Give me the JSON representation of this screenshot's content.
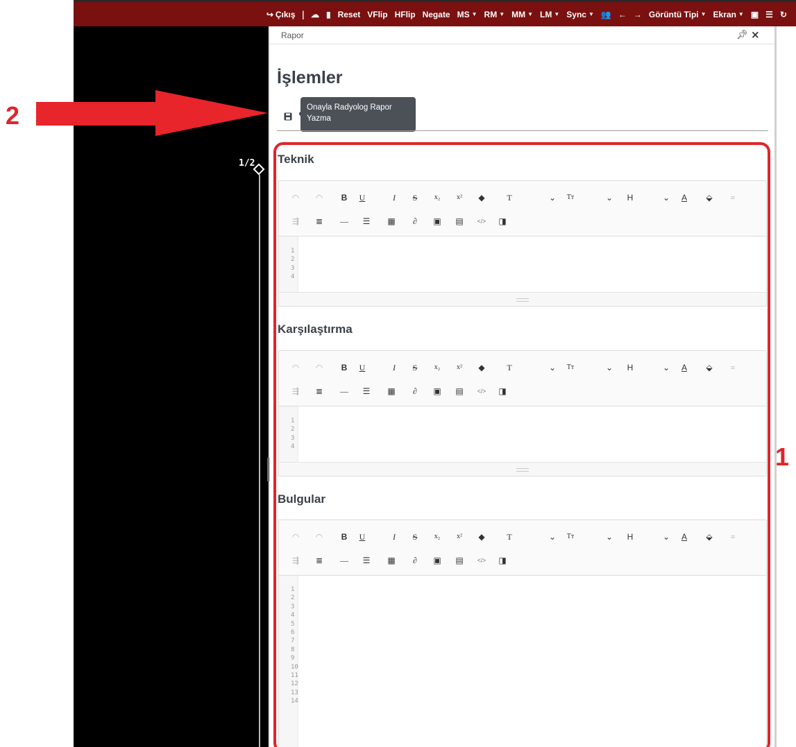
{
  "toolbar": {
    "items": [
      {
        "label": "Çıkış",
        "icon": "logout-icon"
      },
      {
        "label": "|",
        "icon": ""
      },
      {
        "label": "",
        "icon": "cloud-icon"
      },
      {
        "label": "",
        "icon": "file-icon"
      },
      {
        "label": "Reset",
        "icon": ""
      },
      {
        "label": "VFlip",
        "icon": ""
      },
      {
        "label": "HFlip",
        "icon": ""
      },
      {
        "label": "Negate",
        "icon": ""
      },
      {
        "label": "MS",
        "icon": "caret-down-icon"
      },
      {
        "label": "RM",
        "icon": "caret-down-icon"
      },
      {
        "label": "MM",
        "icon": "caret-down-icon"
      },
      {
        "label": "LM",
        "icon": "caret-down-icon"
      },
      {
        "label": "Sync",
        "icon": "caret-down-icon"
      },
      {
        "label": "",
        "icon": "users-icon"
      },
      {
        "label": "←",
        "icon": "arrow-left-icon"
      },
      {
        "label": "→",
        "icon": "arrow-right-icon"
      },
      {
        "label": "Görüntü Tipi",
        "icon": "caret-down-icon"
      },
      {
        "label": "Ekran",
        "icon": "caret-down-icon"
      },
      {
        "label": "",
        "icon": "image-icon"
      },
      {
        "label": "",
        "icon": "list-icon"
      },
      {
        "label": "",
        "icon": "refresh-icon"
      }
    ]
  },
  "viewer": {
    "image_counter": "1/2"
  },
  "panel": {
    "title": "Rapor",
    "pin": "📌",
    "close": "×"
  },
  "page": {
    "title": "İşlemler",
    "save_tooltip": "Onayla Radyolog Rapor Yazma"
  },
  "sections": [
    {
      "title": "Teknik",
      "line_numbers": [
        "1",
        "2",
        "3",
        "4"
      ]
    },
    {
      "title": "Karşılaştırma",
      "line_numbers": [
        "1",
        "2",
        "3",
        "4"
      ]
    },
    {
      "title": "Bulgular",
      "line_numbers": [
        "1",
        "2",
        "3",
        "4",
        "5",
        "6",
        "7",
        "8",
        "9",
        "10",
        "11",
        "12",
        "13",
        "14"
      ]
    }
  ],
  "editor_toolbar": {
    "row1": [
      "↶",
      "↷",
      "B",
      "U",
      "I",
      "S",
      "x₂",
      "x²",
      "eraser",
      "T",
      "⌄",
      "Tт",
      "⌄",
      "H",
      "⌄",
      "A",
      "fill",
      "≡"
    ],
    "row2": [
      "indent",
      "outdent",
      "—",
      "list",
      "table",
      "link",
      "image",
      "template",
      "</>",
      "preview"
    ]
  },
  "annotations": {
    "label_1": "1",
    "label_2": "2"
  },
  "colors": {
    "toolbar_bg": "#7a1010",
    "annotation_red": "#e0242a",
    "tooltip_bg": "#4b5157"
  }
}
